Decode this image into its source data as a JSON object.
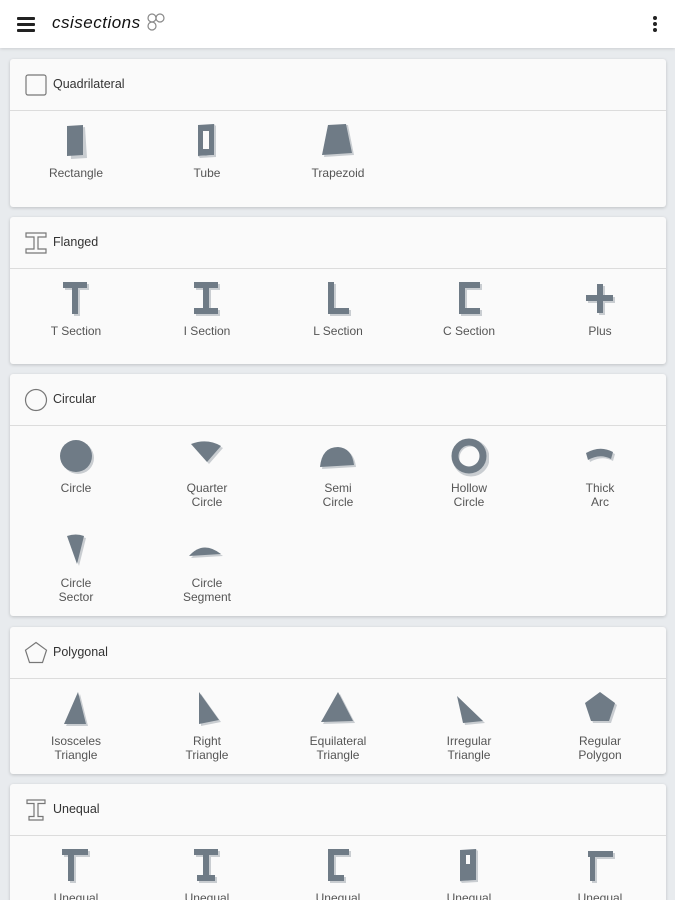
{
  "app": {
    "logo_text": "csisections"
  },
  "sections": [
    {
      "title": "Quadrilateral",
      "items": [
        "Rectangle",
        "Tube",
        "Trapezoid"
      ]
    },
    {
      "title": "Flanged",
      "items": [
        "T Section",
        "I Section",
        "L Section",
        "C Section",
        "Plus"
      ]
    },
    {
      "title": "Circular",
      "items": [
        "Circle",
        "Quarter\nCircle",
        "Semi\nCircle",
        "Hollow\nCircle",
        "Thick\nArc",
        "Circle\nSector",
        "Circle\nSegment"
      ]
    },
    {
      "title": "Polygonal",
      "items": [
        "Isosceles\nTriangle",
        "Right\nTriangle",
        "Equilateral\nTriangle",
        "Irregular\nTriangle",
        "Regular\nPolygon"
      ]
    },
    {
      "title": "Unequal",
      "items": [
        "Unequal",
        "Unequal",
        "Unequal",
        "Unequal",
        "Unequal"
      ]
    }
  ],
  "colors": {
    "shape_fill": "#6f7b86",
    "shape_shadow": "#c9cdd1",
    "background": "#e8ebee",
    "card": "#fafafa"
  },
  "icons": [
    "hamburger-menu-icon",
    "more-vert-icon",
    "square-outline-icon",
    "i-beam-outline-icon",
    "circle-outline-icon",
    "pentagon-outline-icon",
    "unequal-i-beam-outline-icon"
  ]
}
